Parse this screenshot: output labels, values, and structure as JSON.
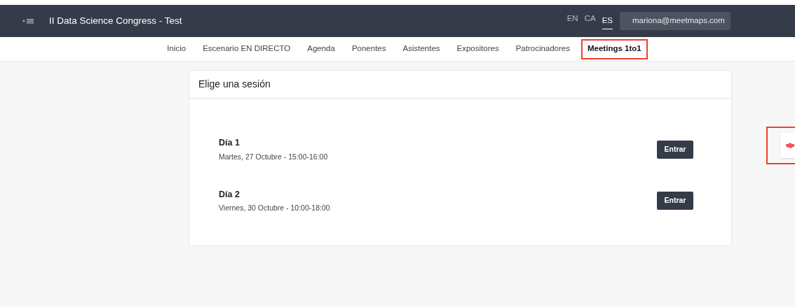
{
  "header": {
    "title": "II Data Science Congress - Test",
    "languages": [
      {
        "label": "EN",
        "selected": false
      },
      {
        "label": "CA",
        "selected": false
      },
      {
        "label": "ES",
        "selected": true
      }
    ],
    "user": "mariona@meetmaps.com"
  },
  "tabs": [
    {
      "label": "Inicio",
      "selected": false
    },
    {
      "label": "Escenario EN DIRECTO",
      "selected": false
    },
    {
      "label": "Agenda",
      "selected": false
    },
    {
      "label": "Ponentes",
      "selected": false
    },
    {
      "label": "Asistentes",
      "selected": false
    },
    {
      "label": "Expositores",
      "selected": false
    },
    {
      "label": "Patrocinadores",
      "selected": false
    },
    {
      "label": "Meetings 1to1",
      "selected": true
    }
  ],
  "card": {
    "title": "Elige una sesión",
    "sessions": [
      {
        "name": "Día 1",
        "time": "Martes, 27 Octubre - 15:00-16:00",
        "button": "Entrar"
      },
      {
        "name": "Día 2",
        "time": "Viernes, 30 Octubre - 10:00-18:00",
        "button": "Entrar"
      }
    ]
  },
  "side_button": {
    "highlighted": true
  }
}
